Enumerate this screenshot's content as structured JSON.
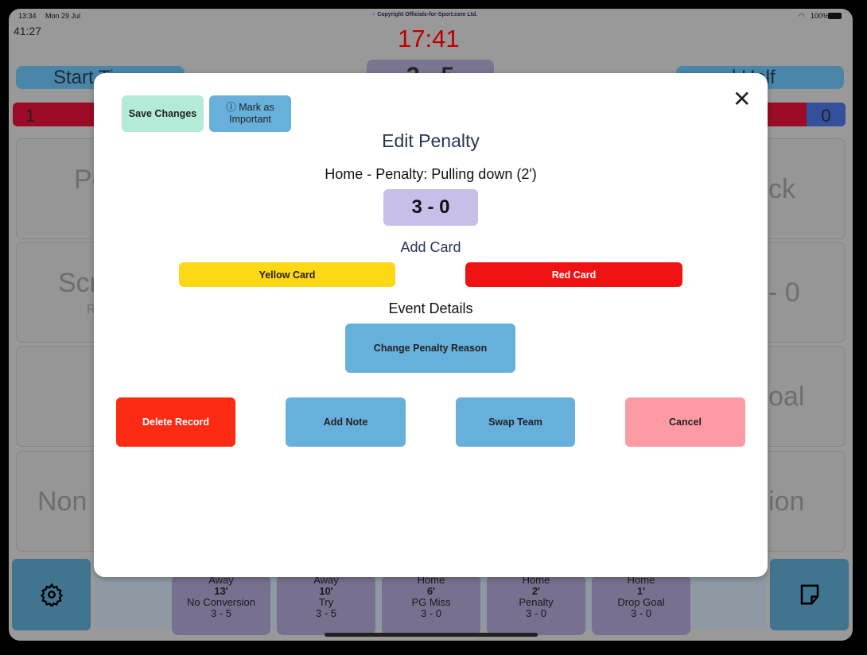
{
  "status_bar": {
    "time": "13:34",
    "date": "Mon 29 Jul",
    "copyright": "Copyright Officials-for-Sport.com Ltd.",
    "battery": "100%"
  },
  "background": {
    "elapsed": "41:27",
    "clock": "17:41",
    "clock_color": "#c00000",
    "start_button": "Start Ti",
    "end_half_button": "d Half",
    "score_fragment": "3 - 5",
    "home_count": "1",
    "away_count": "0",
    "tiles_left": [
      "Pe",
      "Scr",
      "",
      "Non"
    ],
    "tile_left_sub": "R",
    "tiles_right": [
      "ck",
      "- 0",
      "oal",
      "ion"
    ],
    "timeline": [
      {
        "team": "Away",
        "minute": "13'",
        "event": "No Conversion",
        "score": "3 - 5"
      },
      {
        "team": "Away",
        "minute": "10'",
        "event": "Try",
        "score": "3 - 5"
      },
      {
        "team": "Home",
        "minute": "6'",
        "event": "PG Miss",
        "score": "3 - 0"
      },
      {
        "team": "Home",
        "minute": "2'",
        "event": "Penalty",
        "score": "3 - 0"
      },
      {
        "team": "Home",
        "minute": "1'",
        "event": "Drop Goal",
        "score": "3 - 0"
      }
    ]
  },
  "modal": {
    "save_changes": "Save Changes",
    "mark_important": "Mark as Important",
    "title": "Edit Penalty",
    "subtitle": "Home - Penalty: Pulling down (2')",
    "score": "3 - 0",
    "add_card_heading": "Add Card",
    "yellow_card": "Yellow Card",
    "red_card": "Red Card",
    "event_details_heading": "Event Details",
    "change_reason": "Change Penalty Reason",
    "delete_record": "Delete Record",
    "add_note": "Add Note",
    "swap_team": "Swap Team",
    "cancel": "Cancel",
    "colors": {
      "yellow": "#fdd814",
      "red": "#f01212",
      "delete": "#fd2a14",
      "blue": "#67b0dc",
      "cancel": "#fd9ba4",
      "save": "#b3ebd8",
      "score_bg": "#c8bfe9"
    }
  }
}
